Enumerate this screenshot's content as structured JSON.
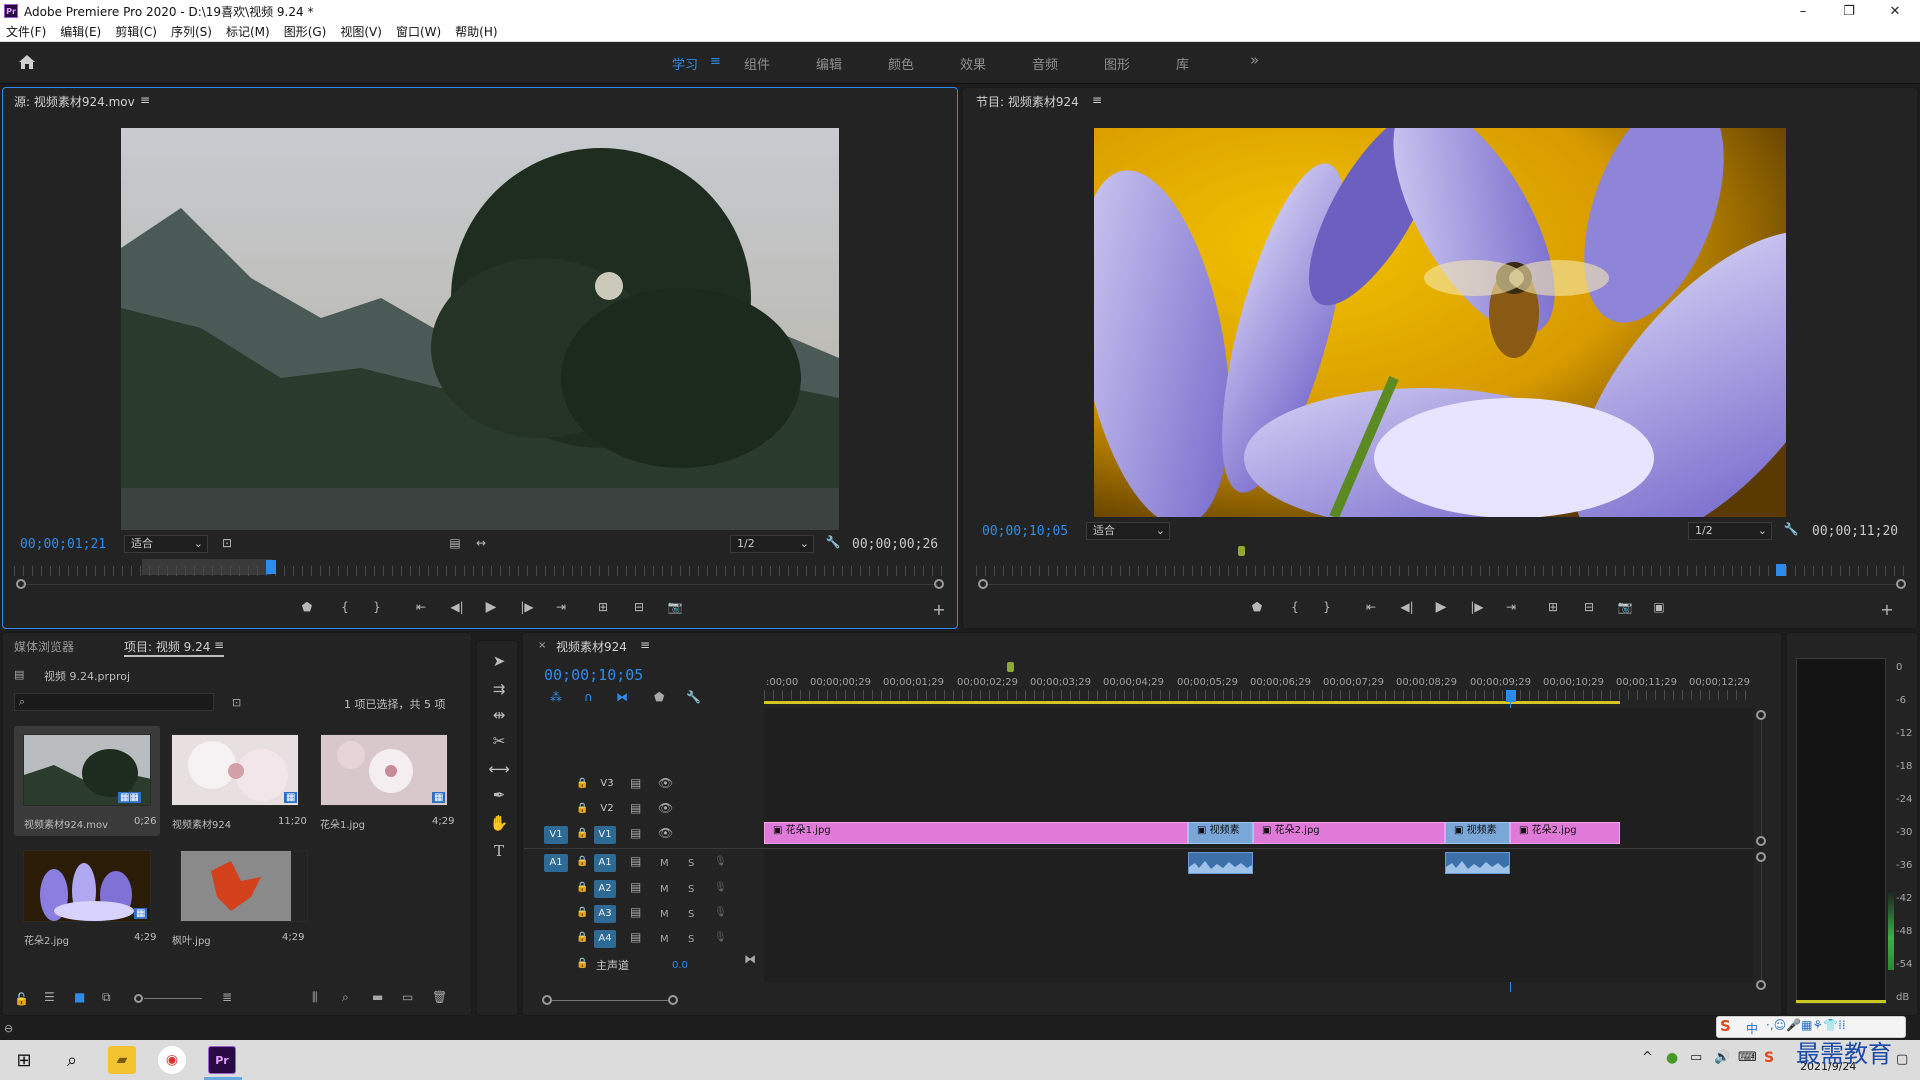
{
  "window": {
    "title": "Adobe Premiere Pro 2020 - D:\\19喜欢\\视频 9.24 *",
    "logo": "Pr",
    "minimize": "–",
    "maximize": "❐",
    "close": "✕"
  },
  "menu": [
    "文件(F)",
    "编辑(E)",
    "剪辑(C)",
    "序列(S)",
    "标记(M)",
    "图形(G)",
    "视图(V)",
    "窗口(W)",
    "帮助(H)"
  ],
  "workspaces": {
    "items": [
      "学习",
      "组件",
      "编辑",
      "颜色",
      "效果",
      "音频",
      "图形",
      "库"
    ],
    "active": "学习",
    "more": "»",
    "menu_icon": "≡"
  },
  "source": {
    "title": "源: 视频素材924.mov",
    "timecode": "00;00;01;21",
    "fit": "适合",
    "resolution": "1/2",
    "duration": "00;00;00;26"
  },
  "program": {
    "title": "节目: 视频素材924",
    "timecode": "00;00;10;05",
    "fit": "适合",
    "resolution": "1/2",
    "duration": "00;00;11;20"
  },
  "project": {
    "tabs": [
      "媒体浏览器",
      "项目: 视频 9.24"
    ],
    "filename": "视频 9.24.prproj",
    "selection": "1 项已选择，共 5 项",
    "items": [
      {
        "name": "视频素材924.mov",
        "dur": "0;26"
      },
      {
        "name": "视频素材924",
        "dur": "11;20"
      },
      {
        "name": "花朵1.jpg",
        "dur": "4;29"
      },
      {
        "name": "花朵2.jpg",
        "dur": "4;29"
      },
      {
        "name": "枫叶.jpg",
        "dur": "4;29"
      }
    ]
  },
  "timeline": {
    "tab": "视频素材924",
    "timecode": "00;00;10;05",
    "ticks": [
      ":00;00",
      "00;00;00;29",
      "00;00;01;29",
      "00;00;02;29",
      "00;00;03;29",
      "00;00;04;29",
      "00;00;05;29",
      "00;00;06;29",
      "00;00;07;29",
      "00;00;08;29",
      "00;00;09;29",
      "00;00;10;29",
      "00;00;11;29",
      "00;00;12;29"
    ],
    "tracks_video": [
      "V3",
      "V2",
      "V1"
    ],
    "tracks_audio": [
      "A1",
      "A2",
      "A3",
      "A4"
    ],
    "source_patch": {
      "video": "V1",
      "audio": "A1"
    },
    "mix_label": "主声道",
    "mix_value": "0.0",
    "mute": "M",
    "solo": "S",
    "clips": [
      {
        "label": "花朵1.jpg",
        "color": "pink"
      },
      {
        "label": "视频素",
        "color": "blue"
      },
      {
        "label": "花朵2.jpg",
        "color": "pink"
      },
      {
        "label": "视频素",
        "color": "blue"
      },
      {
        "label": "花朵2.jpg",
        "color": "pink"
      }
    ]
  },
  "meter": {
    "scale": [
      "0",
      "-6",
      "-12",
      "-18",
      "-24",
      "-30",
      "-36",
      "-42",
      "-48",
      "-54",
      "dB"
    ]
  },
  "taskbar": {
    "ime": "中",
    "date": "2021/9/24",
    "watermark": "最需教育"
  }
}
